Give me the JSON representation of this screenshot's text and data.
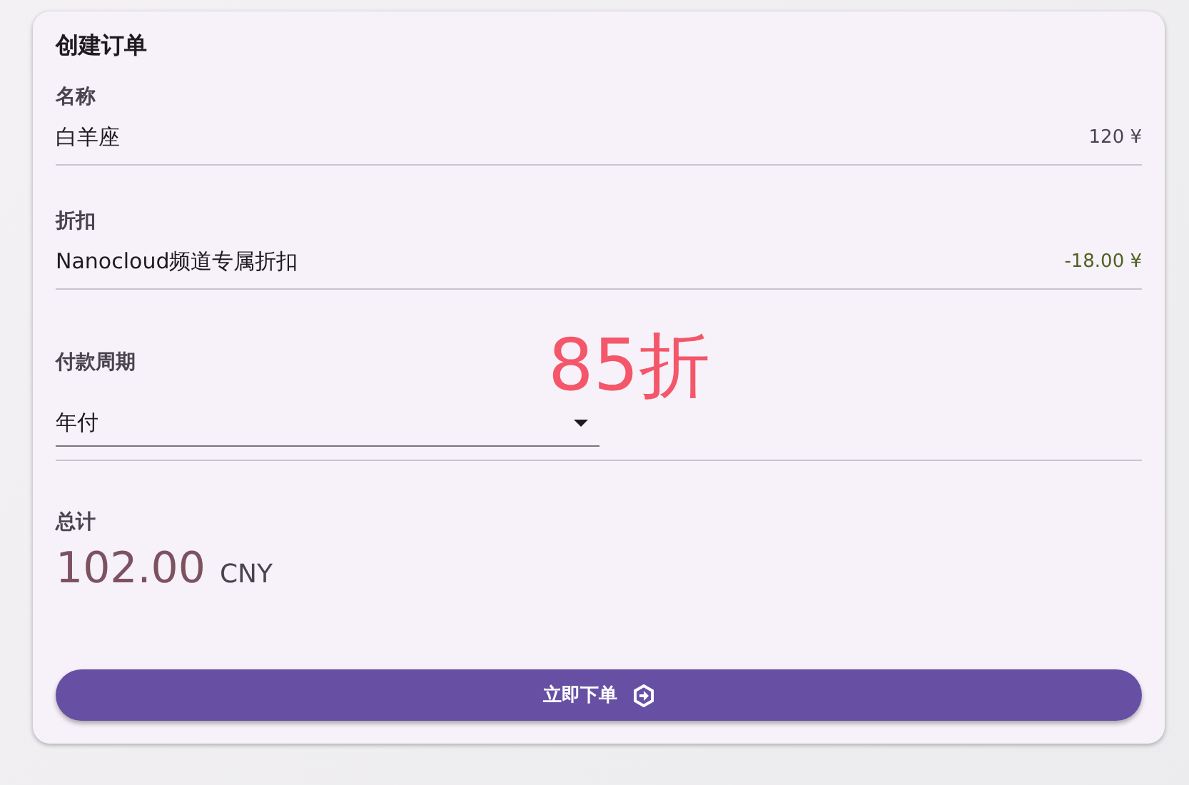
{
  "card": {
    "title": "创建订单"
  },
  "lines": [
    {
      "label": "名称",
      "value": "白羊座",
      "amount": "120 ¥",
      "kind": "plain"
    },
    {
      "label": "折扣",
      "value": "Nanocloud频道专属折扣",
      "amount": "-18.00 ¥",
      "kind": "discount"
    }
  ],
  "billing": {
    "label": "付款周期",
    "value": "年付",
    "badge": "85折"
  },
  "total": {
    "label": "总计",
    "amount": "102.00",
    "currency": "CNY"
  },
  "submit": {
    "label": "立即下单"
  }
}
